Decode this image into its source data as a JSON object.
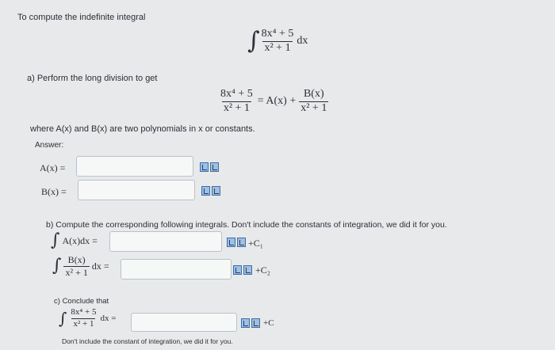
{
  "intro": "To compute the indefinite integral",
  "main_integral": {
    "numerator": "8x⁴ + 5",
    "denominator": "x² + 1",
    "dx": "dx"
  },
  "part_a": {
    "label": "a)",
    "instruction": "Perform the long division to get",
    "equation": {
      "lhs_num": "8x⁴ + 5",
      "lhs_den": "x² + 1",
      "middle": "= A(x) +",
      "rhs_num": "B(x)",
      "rhs_den": "x² + 1"
    },
    "where_text": "where A(x) and B(x) are two polynomials in x or constants.",
    "answer_label": "Answer:",
    "A_label": "A(x) =",
    "B_label": "B(x) =",
    "A_value": "",
    "B_value": ""
  },
  "part_b": {
    "label": "b)",
    "instruction": "Compute the corresponding following integrals. Don't include the constants of integration, we did it for you.",
    "int1_expr": "A(x)dx =",
    "int1_const": "+C₁",
    "int2_num": "B(x)",
    "int2_den": "x² + 1",
    "int2_dx": "dx =",
    "int2_const": "+C₂",
    "int1_value": "",
    "int2_value": ""
  },
  "part_c": {
    "label": "c)",
    "instruction": "Conclude that",
    "int_num": "8x⁴ + 5",
    "int_den": "x² + 1",
    "int_dx": "dx =",
    "const": "+C",
    "value": "",
    "note": "Don't include the constant of integration, we did it for you."
  }
}
